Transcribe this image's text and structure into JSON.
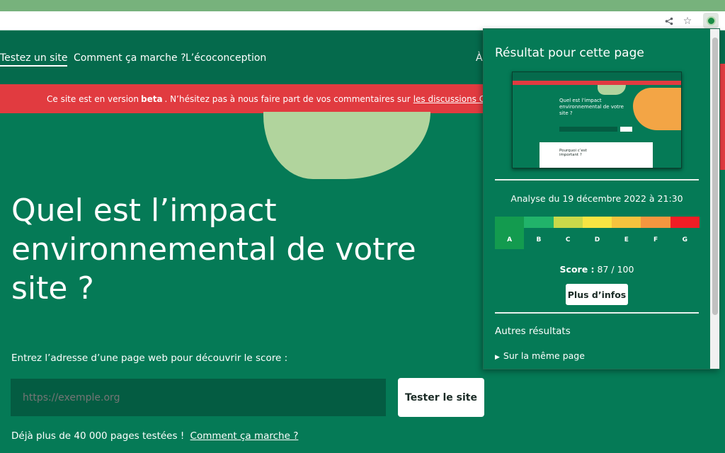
{
  "site": {
    "nav": {
      "items": [
        {
          "label": "Testez un site",
          "active": true
        },
        {
          "label": "Comment ça marche ?",
          "active": false
        },
        {
          "label": "L’écoconception",
          "active": false
        }
      ],
      "right_label": "À"
    },
    "beta_banner": {
      "prefix": "Ce site est en version",
      "bold": "beta",
      "middle": ". N’hésitez pas à nous faire part de vos commentaires sur",
      "link": "les discussions Github"
    },
    "hero": {
      "title": "Quel est l’impact environnemental de votre site ?",
      "input_label": "Entrez l’adresse d’une page web pour découvrir le score :",
      "input_placeholder": "https://exemple.org",
      "submit_label": "Tester le site",
      "tested_text": "Déjà plus de 40 000 pages testées !",
      "tested_link": "Comment ça marche ?"
    }
  },
  "popup": {
    "title": "Résultat pour cette page",
    "thumbnail": {
      "title": "Quel est l’impact environnemental de votre site ?",
      "card_text": "Pourquoi c’est important ?"
    },
    "analysis_date": "Analyse du 19 décembre 2022 à 21:30",
    "grades": [
      {
        "letter": "A",
        "color": "#139b4f",
        "active": true
      },
      {
        "letter": "B",
        "color": "#21b36a",
        "active": false
      },
      {
        "letter": "C",
        "color": "#c9d94a",
        "active": false
      },
      {
        "letter": "D",
        "color": "#f8e443",
        "active": false
      },
      {
        "letter": "E",
        "color": "#f5c33e",
        "active": false
      },
      {
        "letter": "F",
        "color": "#f4963f",
        "active": false
      },
      {
        "letter": "G",
        "color": "#f01d25",
        "active": false
      }
    ],
    "score_label": "Score :",
    "score_value": "87 / 100",
    "more_button": "Plus d’infos",
    "other_results_title": "Autres résultats",
    "same_page_label": "Sur la même page"
  },
  "icons": [
    "share-icon",
    "star-icon",
    "extension-icon"
  ]
}
